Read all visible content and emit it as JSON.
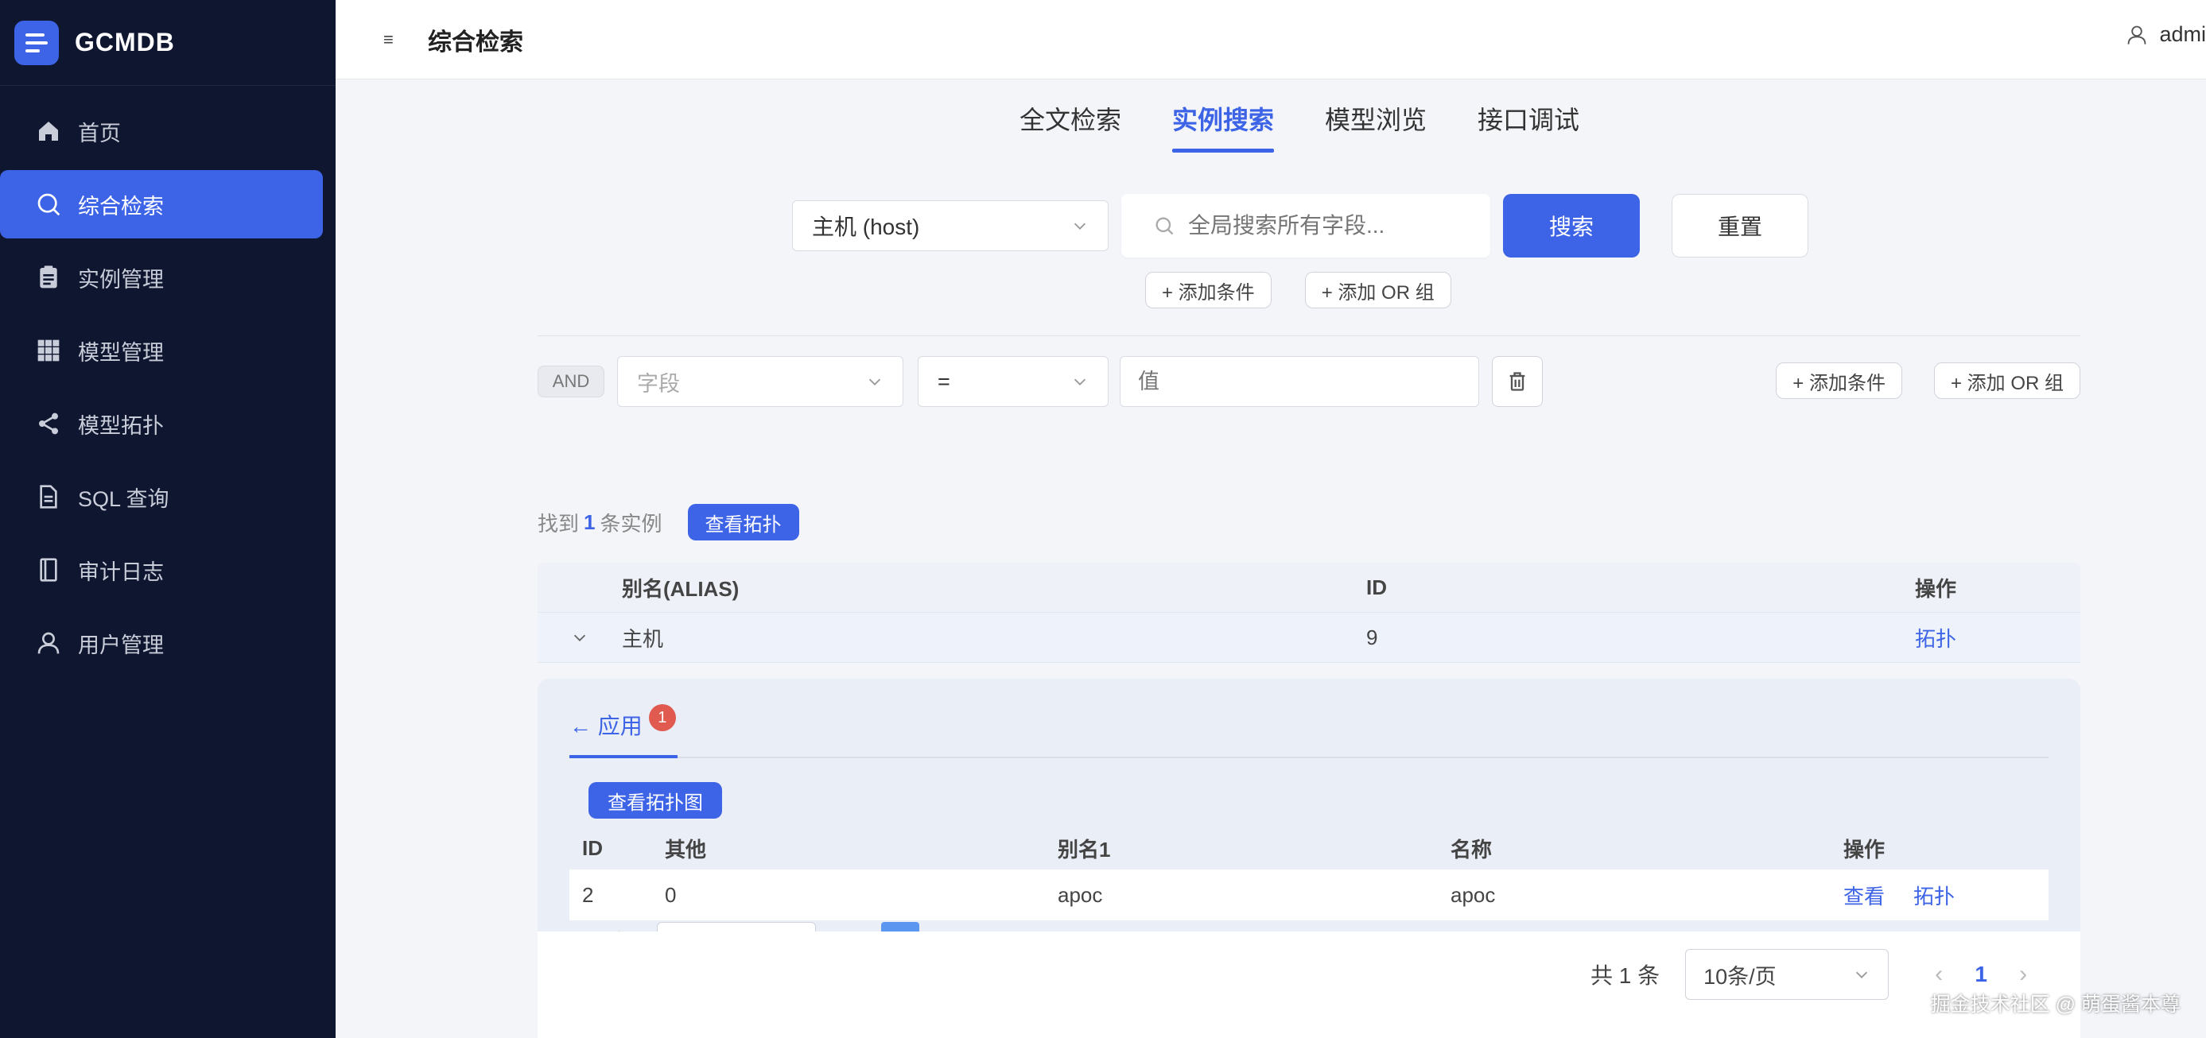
{
  "brand": {
    "name": "GCMDB"
  },
  "sidebar": {
    "items": [
      {
        "label": "首页",
        "icon": "home-icon"
      },
      {
        "label": "综合检索",
        "icon": "search-icon",
        "active": true
      },
      {
        "label": "实例管理",
        "icon": "clipboard-icon"
      },
      {
        "label": "模型管理",
        "icon": "grid-icon"
      },
      {
        "label": "模型拓扑",
        "icon": "share-icon"
      },
      {
        "label": "SQL 查询",
        "icon": "document-icon"
      },
      {
        "label": "审计日志",
        "icon": "notebook-icon"
      },
      {
        "label": "用户管理",
        "icon": "user-icon"
      }
    ]
  },
  "header": {
    "menu_glyph": "≡",
    "title": "综合检索",
    "user": "admi"
  },
  "tabs": [
    {
      "label": "全文检索"
    },
    {
      "label": "实例搜索",
      "active": true
    },
    {
      "label": "模型浏览"
    },
    {
      "label": "接口调试"
    }
  ],
  "search": {
    "model_value": "主机 (host)",
    "placeholder": "全局搜索所有字段...",
    "search_label": "搜索",
    "reset_label": "重置",
    "add_condition": "+ 添加条件",
    "add_or_group": "+ 添加 OR 组"
  },
  "condition": {
    "logic": "AND",
    "field_placeholder": "字段",
    "operator": "=",
    "value_placeholder": "值",
    "add_condition": "+ 添加条件",
    "add_or_group": "+ 添加 OR 组"
  },
  "result": {
    "prefix": "找到",
    "count": "1",
    "suffix": "条实例",
    "topo_button": "查看拓扑"
  },
  "table": {
    "headers": {
      "alias": "别名(ALIAS)",
      "id": "ID",
      "op": "操作"
    },
    "rows": [
      {
        "alias": "主机",
        "id": "9",
        "op": "拓扑"
      }
    ]
  },
  "detail": {
    "tab_label": "← 应用",
    "badge": "1",
    "topo_graph_button": "查看拓扑图",
    "headers": {
      "id": "ID",
      "other": "其他",
      "alias1": "别名1",
      "name": "名称",
      "op": "操作"
    },
    "rows": [
      {
        "id": "2",
        "other": "0",
        "alias1": "apoc",
        "name": "apoc",
        "view": "查看",
        "topo": "拓扑"
      }
    ],
    "pager": {
      "total": "共 1 条",
      "page_size": "10条/页",
      "prev": "‹",
      "page": "1",
      "next": "›"
    }
  },
  "pager": {
    "total": "共 1 条",
    "page_size": "10条/页",
    "prev": "‹",
    "page": "1",
    "next": "›"
  },
  "watermark": "掘金技术社区 @ 萌蛋酱本尊",
  "colors": {
    "primary": "#3d63e6",
    "sidebar_bg": "#0f1630",
    "badge": "#e05a4f"
  }
}
